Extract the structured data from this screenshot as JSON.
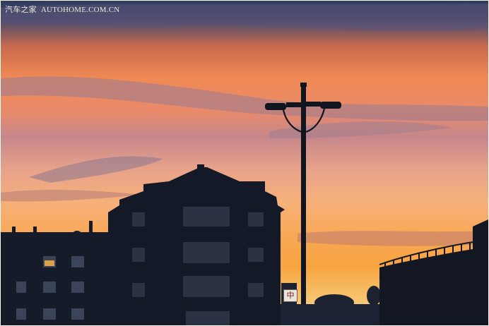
{
  "watermark": {
    "brand": "汽车之家",
    "site": "AUTOHOME.COM.CN"
  },
  "sign": {
    "text": "中"
  },
  "colors": {
    "sky_top": "#2e3c5e",
    "sky_orange": "#f08a55",
    "sky_glow": "#f7a440",
    "silhouette": "#141a26"
  }
}
